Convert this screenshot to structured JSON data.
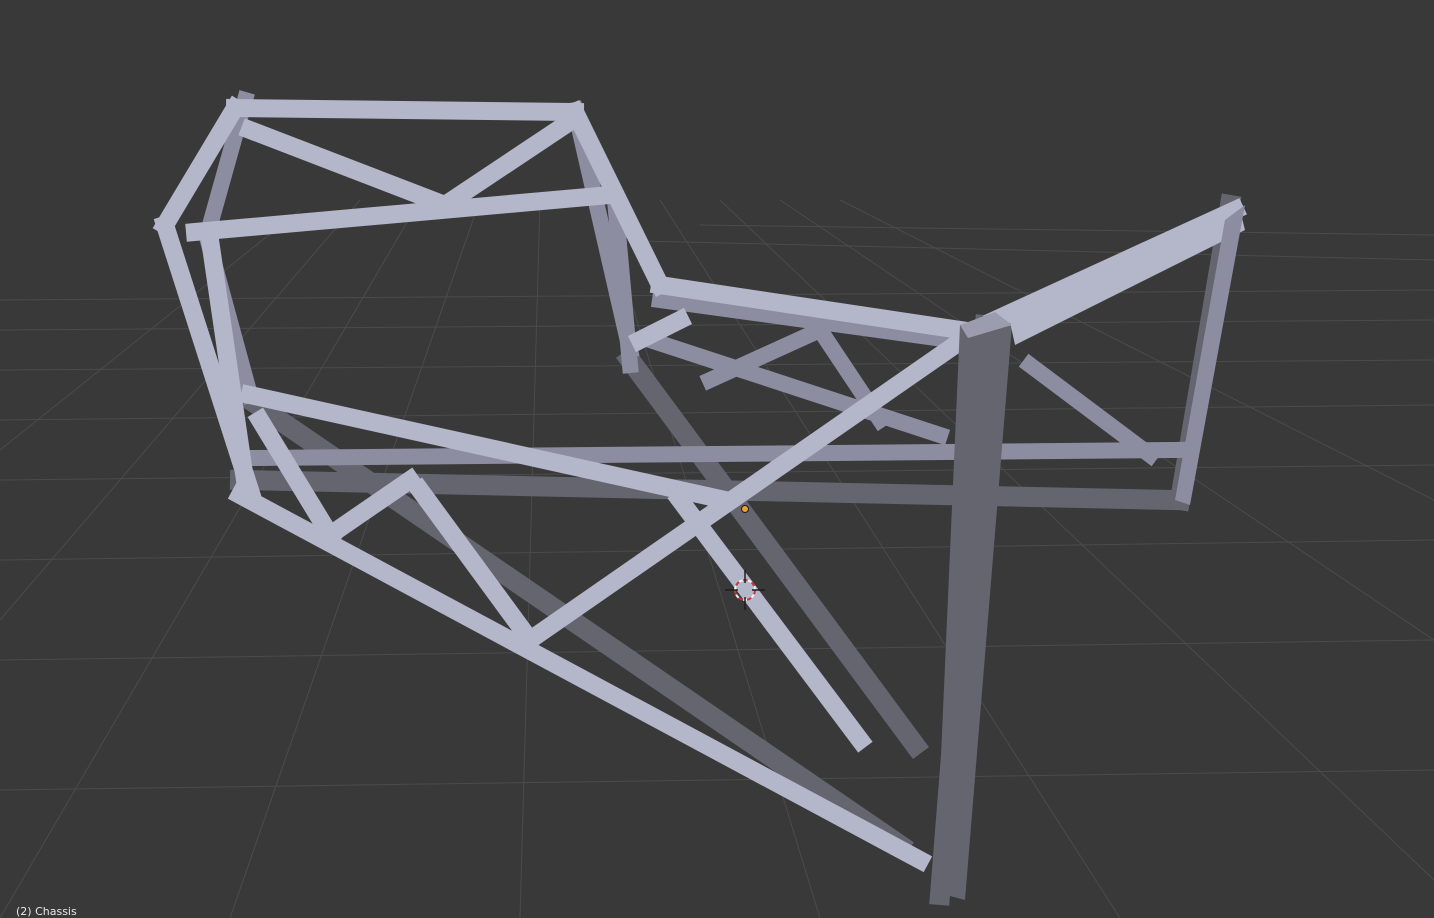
{
  "viewport": {
    "object_info": "(2) Chassis",
    "colors": {
      "background": "#393939",
      "grid_line": "#4b4b4b",
      "tube_light": "#b4b6c9",
      "tube_mid": "#8c8da0",
      "tube_dark": "#656570",
      "origin_point": "#f0a030",
      "cursor_red": "#cc3333",
      "cursor_white": "#f2f2f2"
    },
    "icons": [
      "3d-cursor-icon",
      "object-origin-icon"
    ]
  }
}
